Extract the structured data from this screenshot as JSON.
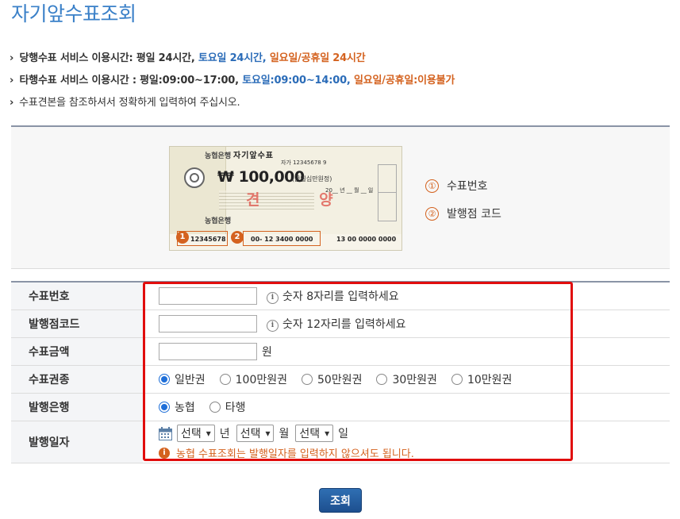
{
  "page": {
    "title": "자기앞수표조회"
  },
  "info": {
    "line1": {
      "mark": "›",
      "label": "당행수표 서비스 이용시간: 평일 24시간,",
      "blue": "토요일 24시간,",
      "orange": "일요일/공휴일 24시간"
    },
    "line2": {
      "mark": "›",
      "label": "타행수표 서비스 이용시간 : 평일:09:00~17:00,",
      "blue": "토요일:09:00~14:00,",
      "orange": "일요일/공휴일:이용불가"
    },
    "line3": {
      "mark": "›",
      "text": "수표견본을 참조하셔서 정확하게 입력하여 주십시오."
    }
  },
  "sample": {
    "check_title": "자기앞수표",
    "check_no": "자가 12345678 9",
    "amount": "₩ 100,000",
    "amount_sub": "(금일십만원정)",
    "stamp": "견 양",
    "date": "20__ 년 __ 월 __ 일",
    "bank_top": "농협은행",
    "bank_bottom": "농협은행",
    "code1": "12345678",
    "code2": "00- 12 3400 0000",
    "code3": "13 00 0000 0000",
    "num1": "1",
    "num2": "2",
    "legend": [
      {
        "num": "①",
        "label": "수표번호"
      },
      {
        "num": "②",
        "label": "발행점 코드"
      }
    ]
  },
  "form": {
    "rows": {
      "check_number": {
        "label": "수표번호",
        "value": "",
        "hint": "숫자 8자리를 입력하세요"
      },
      "branch_code": {
        "label": "발행점코드",
        "value": "",
        "hint": "숫자 12자리를 입력하세요"
      },
      "amount": {
        "label": "수표금액",
        "value": "",
        "unit": "원"
      },
      "type": {
        "label": "수표권종",
        "options": [
          "일반권",
          "100만원권",
          "50만원권",
          "30만원권",
          "10만원권"
        ],
        "selected": "일반권"
      },
      "bank": {
        "label": "발행은행",
        "options": [
          "농협",
          "타행"
        ],
        "selected": "농협"
      },
      "date": {
        "label": "발행일자",
        "year": "선택",
        "year_unit": "년",
        "month": "선택",
        "month_unit": "월",
        "day": "선택",
        "day_unit": "일",
        "warning": "농협 수표조회는 발행일자를 입력하지 않으셔도 됩니다."
      }
    }
  },
  "button": {
    "label": "조회"
  },
  "colors": {
    "title": "#3a80c8",
    "accent_orange": "#d4621f",
    "accent_blue": "#2b6cb8",
    "highlight": "#e10d0d",
    "button": "#1d4f8f"
  },
  "icons": [
    "info-icon",
    "calendar-icon",
    "warning-icon",
    "chevron-down-icon"
  ]
}
